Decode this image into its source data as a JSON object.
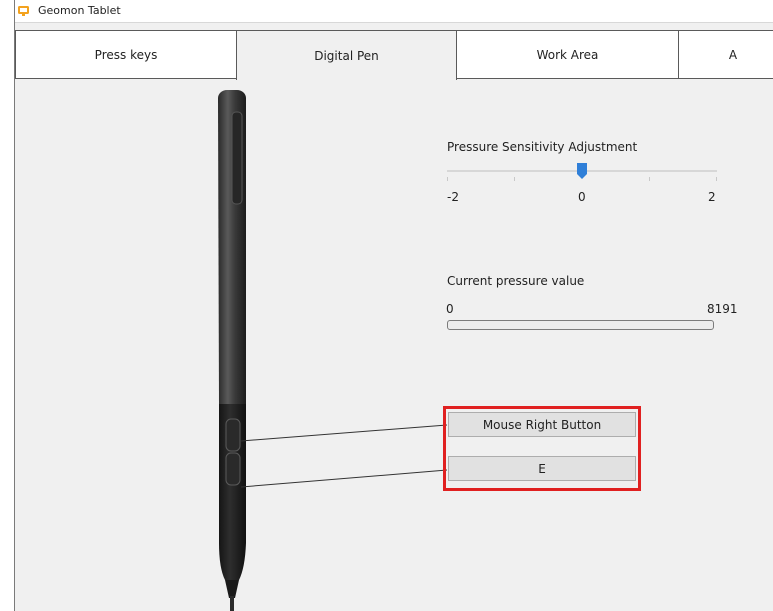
{
  "window": {
    "title": "Geomon Tablet"
  },
  "tabs": [
    {
      "label": "Press keys"
    },
    {
      "label": "Digital Pen"
    },
    {
      "label": "Work Area"
    },
    {
      "label": "A"
    }
  ],
  "pressure_sensitivity": {
    "label": "Pressure Sensitivity Adjustment",
    "min": "-2",
    "mid": "0",
    "max": "2",
    "value": 0
  },
  "current_pressure": {
    "label": "Current pressure value",
    "min": "0",
    "max": "8191",
    "value": 0
  },
  "pen_buttons": {
    "upper": "Mouse Right Button",
    "lower": "E"
  },
  "colors": {
    "highlight": "#e02020",
    "slider_thumb": "#2f7fd8"
  },
  "icons": [
    "app-icon",
    "digital-pen-icon"
  ]
}
